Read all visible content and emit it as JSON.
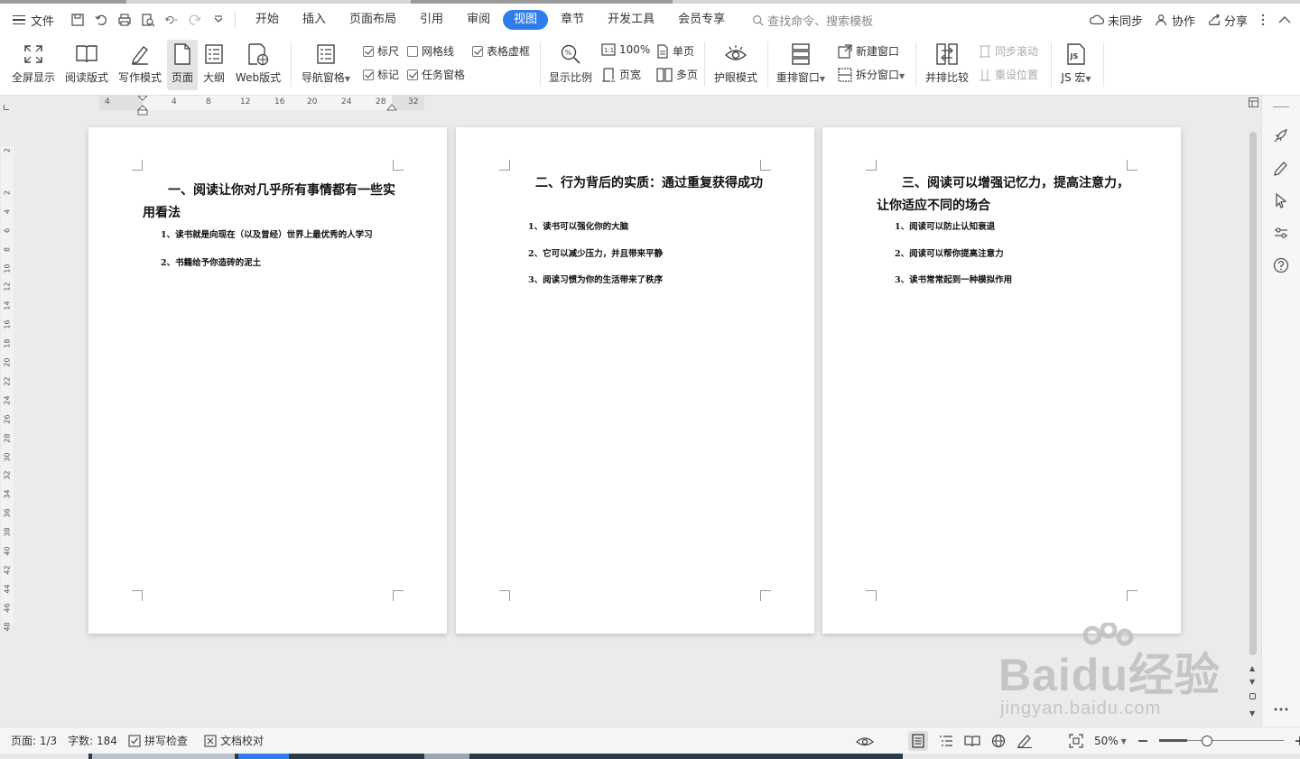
{
  "menu": {
    "file_label": "文件",
    "tabs": [
      {
        "label": "开始",
        "active": false
      },
      {
        "label": "插入",
        "active": false
      },
      {
        "label": "页面布局",
        "active": false
      },
      {
        "label": "引用",
        "active": false
      },
      {
        "label": "审阅",
        "active": false
      },
      {
        "label": "视图",
        "active": true
      },
      {
        "label": "章节",
        "active": false
      },
      {
        "label": "开发工具",
        "active": false
      },
      {
        "label": "会员专享",
        "active": false
      }
    ],
    "search_placeholder": "查找命令、搜索模板",
    "sync_label": "未同步",
    "collab_label": "协作",
    "share_label": "分享"
  },
  "ribbon": {
    "fullscreen": "全屏显示",
    "reading": "阅读版式",
    "writing": "写作模式",
    "page": "页面",
    "outline": "大纲",
    "web": "Web版式",
    "nav_pane": "导航窗格",
    "ruler": "标尺",
    "gridlines": "网格线",
    "table_gridlines": "表格虚框",
    "marks": "标记",
    "task_pane": "任务窗格",
    "zoom": "显示比例",
    "hundred": "100%",
    "single_page": "单页",
    "page_width": "页宽",
    "multi_page": "多页",
    "eye_care": "护眼模式",
    "rearrange": "重排窗口",
    "new_window": "新建窗口",
    "split_window": "拆分窗口",
    "side_by_side": "并排比较",
    "sync_scroll": "同步滚动",
    "reset_position": "重设位置",
    "macro": "JS 宏"
  },
  "ruler": {
    "h_numbers": [
      "4",
      "4",
      "8",
      "12",
      "16",
      "20",
      "24",
      "28",
      "32"
    ],
    "v_numbers": [
      "2",
      "2",
      "4",
      "6",
      "8",
      "10",
      "12",
      "14",
      "16",
      "18",
      "20",
      "22",
      "24",
      "26",
      "28",
      "30",
      "32",
      "34",
      "36",
      "38",
      "40",
      "42",
      "44",
      "46",
      "48"
    ]
  },
  "pages": [
    {
      "title": "一、阅读让你对几乎所有事情都有一些实用看法",
      "items": [
        "1、读书就是向现在（以及曾经）世界上最优秀的人学习",
        "2、书籍给予你造砖的泥土"
      ]
    },
    {
      "title": "二、行为背后的实质：通过重复获得成功",
      "items": [
        "1、读书可以强化你的大脑",
        "2、它可以减少压力，并且带来平静",
        "3、阅读习惯为你的生活带来了秩序"
      ]
    },
    {
      "title": "三、阅读可以增强记忆力，提高注意力，让你适应不同的场合",
      "items": [
        "1、阅读可以防止认知衰退",
        "2、阅读可以帮你提高注意力",
        "3、读书常常起到一种模拟作用"
      ]
    }
  ],
  "status": {
    "page": "页面: 1/3",
    "words": "字数: 184",
    "spell_check": "拼写检查",
    "doc_proof": "文档校对",
    "zoom": "50%",
    "zoom_fraction": 0.5
  },
  "watermark": {
    "brand": "Baidu经验",
    "url": "jingyan.baidu.com"
  },
  "colors": {
    "accent": "#2f7dea",
    "page_bg": "#ebebeb",
    "ribbon_bg": "#ffffff"
  }
}
